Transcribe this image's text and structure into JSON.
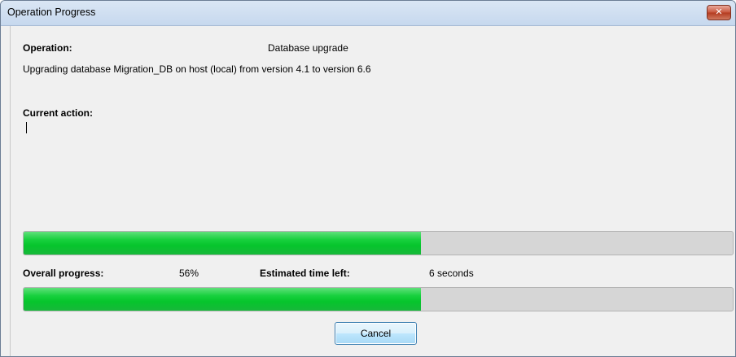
{
  "window": {
    "title": "Operation Progress",
    "close_glyph": "✕"
  },
  "operation": {
    "label": "Operation:",
    "value": "Database upgrade",
    "description": "Upgrading database Migration_DB on host (local) from version 4.1 to version 6.6"
  },
  "current_action": {
    "label": "Current action:",
    "value": ""
  },
  "progress": {
    "step_progress_fraction": 0.56,
    "overall_progress_fraction": 0.56,
    "overall_label": "Overall progress:",
    "overall_value": "56%",
    "time_left_label": "Estimated time left:",
    "time_left_value": "6 seconds"
  },
  "buttons": {
    "cancel_label": "Cancel"
  },
  "colors": {
    "progress_fill": "#06c52c",
    "progress_track": "#d6d6d6",
    "background": "#f0f0f0"
  },
  "icons": {
    "close": "close-icon"
  }
}
